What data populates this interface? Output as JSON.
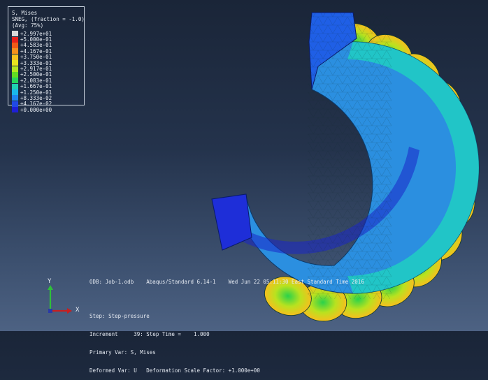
{
  "legend": {
    "title": "S, Mises",
    "subtitle": "SNEG, (fraction = -1.0)",
    "avg": "(Avg: 75%)",
    "entries": [
      {
        "label": "+2.997e+01",
        "color": "#d9d9d9"
      },
      {
        "label": "+5.000e-01",
        "color": "#e8201a"
      },
      {
        "label": "+4.583e-01",
        "color": "#f05a17"
      },
      {
        "label": "+4.167e-01",
        "color": "#f4901c"
      },
      {
        "label": "+3.750e-01",
        "color": "#f6c21e"
      },
      {
        "label": "+3.333e-01",
        "color": "#e9e51f"
      },
      {
        "label": "+2.917e-01",
        "color": "#b5e81f"
      },
      {
        "label": "+2.500e-01",
        "color": "#62dd22"
      },
      {
        "label": "+2.083e-01",
        "color": "#26d65a"
      },
      {
        "label": "+1.667e-01",
        "color": "#1fd1b0"
      },
      {
        "label": "+1.250e-01",
        "color": "#1ab7ea"
      },
      {
        "label": "+8.333e-02",
        "color": "#1e84f0"
      },
      {
        "label": "+4.167e-02",
        "color": "#2049e6"
      },
      {
        "label": "+0.000e+00",
        "color": "#1e1fd6"
      }
    ]
  },
  "triad": {
    "y_label": "Y",
    "x_label": "X"
  },
  "odb_line": "ODB: Job-1.odb    Abaqus/Standard 6.14-1    Wed Jun 22 05:11:30 East Standard Time 2016",
  "step_info": {
    "line1": "Step: Step-pressure",
    "line2": "Increment     39: Step Time =    1.000",
    "line3": "Primary Var: S, Mises",
    "line4": "Deformed Var: U   Deformation Scale Factor: +1.000e+00"
  },
  "colors": {
    "background_top": "#1a2538",
    "background_bottom": "#4d6283"
  }
}
